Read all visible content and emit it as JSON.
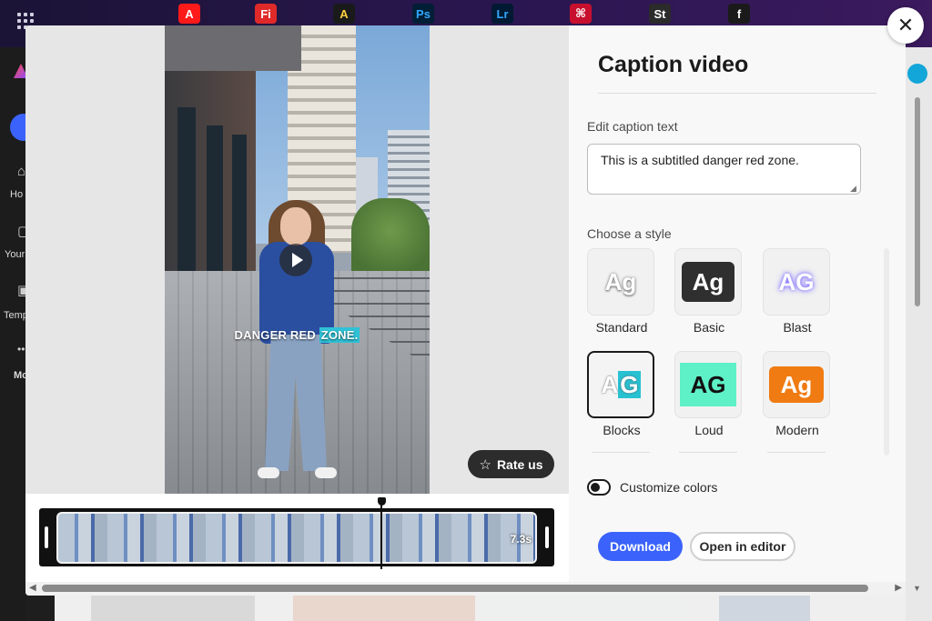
{
  "topbar": {
    "apps": [
      {
        "name": "acrobat",
        "glyph": "A",
        "bg": "#ff1a1a",
        "fg": "#ffffff"
      },
      {
        "name": "fresco",
        "glyph": "Fi",
        "bg": "#e02a2a",
        "fg": "#ffffff"
      },
      {
        "name": "express",
        "glyph": "A",
        "bg": "#1a1a1a",
        "fg": "#ffcf3d"
      },
      {
        "name": "photoshop",
        "glyph": "Ps",
        "bg": "#001e36",
        "fg": "#31a8ff"
      },
      {
        "name": "lightroom",
        "glyph": "Lr",
        "bg": "#001a33",
        "fg": "#31a8ff"
      },
      {
        "name": "acrobat-pdf",
        "glyph": "⌘",
        "bg": "#c8102e",
        "fg": "#ffffff"
      },
      {
        "name": "stock",
        "glyph": "St",
        "bg": "#2b2b2b",
        "fg": "#ffffff"
      },
      {
        "name": "fonts",
        "glyph": "f",
        "bg": "#1a1a1a",
        "fg": "#ffffff"
      }
    ]
  },
  "leftnav": {
    "home": "Ho",
    "your": "Your",
    "templates": "Temp",
    "more": "Mo"
  },
  "modal": {
    "title": "Caption video",
    "edit_caption_label": "Edit caption text",
    "caption_value": "This is a subtitled danger red zone.",
    "choose_style_label": "Choose a style",
    "styles": [
      {
        "name": "Standard",
        "swatch": "Ag"
      },
      {
        "name": "Basic",
        "swatch": "Ag"
      },
      {
        "name": "Blast",
        "swatch": "AG"
      },
      {
        "name": "Blocks",
        "swatch_a": "A",
        "swatch_b": "G"
      },
      {
        "name": "Loud",
        "swatch": "AG"
      },
      {
        "name": "Modern",
        "swatch": "Ag"
      }
    ],
    "customize_colors_label": "Customize colors",
    "download_label": "Download",
    "open_editor_label": "Open in editor",
    "rate_us_label": "Rate us",
    "caption_overlay_part1": "DANGER RED ",
    "caption_overlay_part2": "ZONE.",
    "timeline_duration": "7.3s"
  },
  "colors": {
    "accent": "#3b63fb",
    "caption_highlight": "#2fc2d6"
  }
}
